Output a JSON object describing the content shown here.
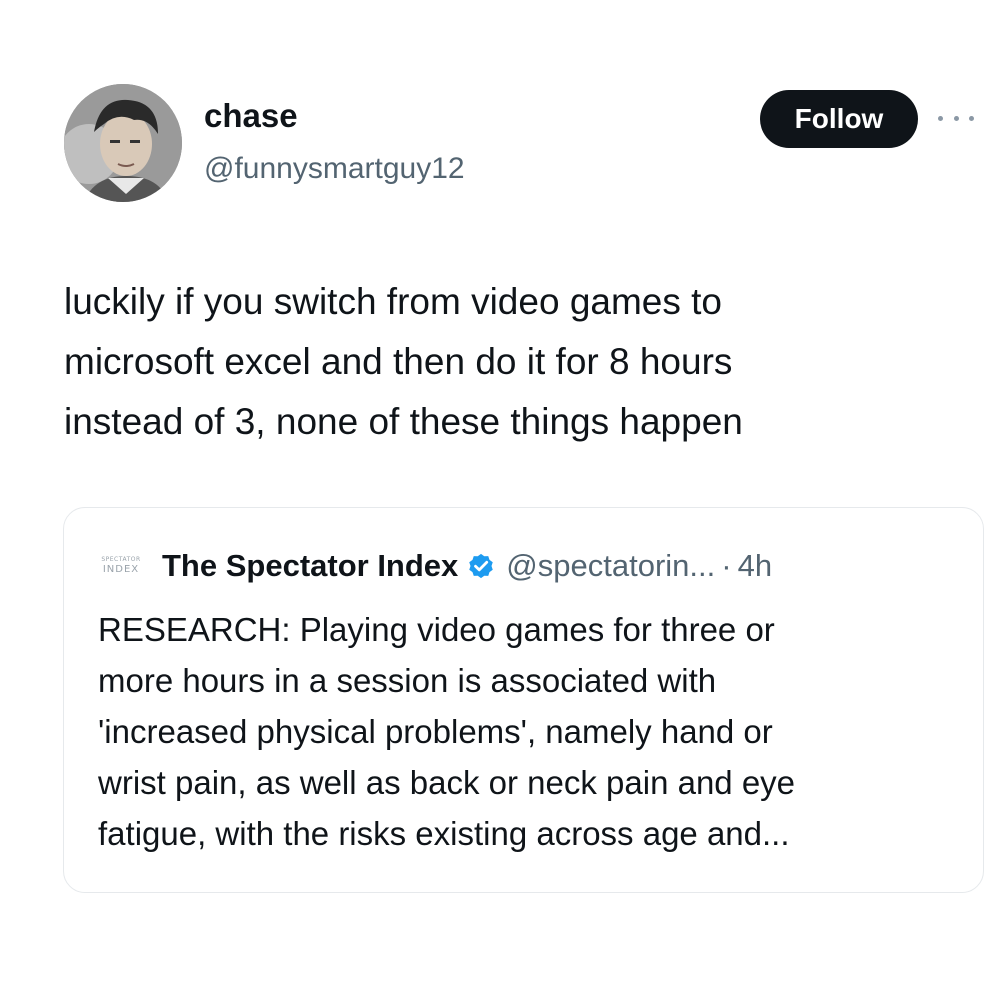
{
  "tweet": {
    "author": {
      "display_name": "chase",
      "handle": "@funnysmartguy12"
    },
    "follow_label": "Follow",
    "more_icon": "more-horizontal-icon",
    "text": "luckily if you switch from video games to\nmicrosoft excel and then do it for 8 hours\ninstead of 3, none of these things happen"
  },
  "quote": {
    "logo_text_top": "SPECTATOR",
    "logo_text_bottom": "INDEX",
    "name": "The Spectator Index",
    "verified_icon": "verified-badge-icon",
    "handle": "@spectatorin...",
    "separator": "·",
    "time": "4h",
    "text": "RESEARCH: Playing video games for three or\nmore hours in a session is associated with\n'increased physical problems', namely hand or\nwrist pain, as well as back or neck pain and eye\nfatigue, with the risks existing across age and..."
  },
  "colors": {
    "text_primary": "#0f1419",
    "text_secondary": "#536471",
    "follow_bg": "#0f1419",
    "verified_blue": "#1d9bf0",
    "card_border": "#e6e9ec"
  }
}
